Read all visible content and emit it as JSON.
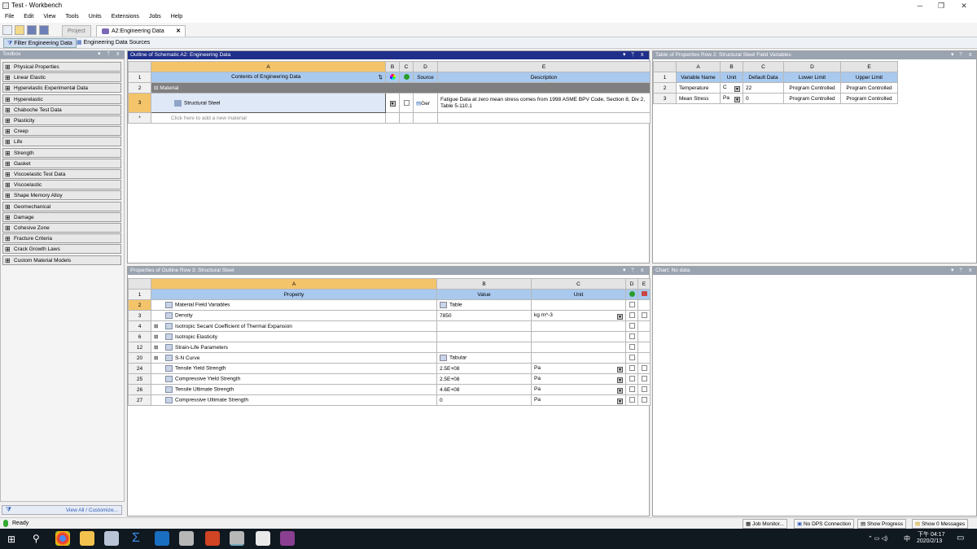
{
  "window": {
    "title": "Test - Workbench"
  },
  "menu": [
    "File",
    "Edit",
    "View",
    "Tools",
    "Units",
    "Extensions",
    "Jobs",
    "Help"
  ],
  "tabs": {
    "project": "Project",
    "engineering": "A2:Engineering Data"
  },
  "subbar": {
    "filter": "Filter Engineering Data",
    "sources": "Engineering Data Sources"
  },
  "toolbox": {
    "title": "Toolbox",
    "items": [
      "Physical Properties",
      "Linear Elastic",
      "Hyperelastic Experimental Data",
      "Hyperelastic",
      "Chaboche Test Data",
      "Plasticity",
      "Creep",
      "Life",
      "Strength",
      "Gasket",
      "Viscoelastic Test Data",
      "Viscoelastic",
      "Shape Memory Alloy",
      "Geomechanical",
      "Damage",
      "Cohesive Zone",
      "Fracture Criteria",
      "Crack Growth Laws",
      "Custom Material Models"
    ],
    "footer": "View All / Customize..."
  },
  "outline": {
    "title": "Outline of Schematic A2: Engineering Data",
    "cols": [
      "A",
      "B",
      "C",
      "D",
      "E"
    ],
    "header": {
      "contents": "Contents of Engineering Data",
      "source": "Source",
      "description": "Description"
    },
    "group": "Material",
    "material": {
      "name": "Structural Steel",
      "source": "Ger",
      "description": "Fatigue Data at zero mean stress comes from 1998 ASME BPV Code, Section 8, Div 2, Table 5-110.1"
    },
    "add_hint": "Click here to add a new material",
    "rows": [
      "1",
      "2",
      "3",
      "*"
    ]
  },
  "fieldvars": {
    "title": "Table of Properties Row 2: Structural Steel Field Variables",
    "cols": [
      "A",
      "B",
      "C",
      "D",
      "E"
    ],
    "header": [
      "Variable Name",
      "Unit",
      "Default Data",
      "Lower Limit",
      "Upper Limit"
    ],
    "rows": [
      {
        "n": "2",
        "name": "Temperature",
        "unit": "C",
        "def": "22",
        "lower": "Program Controlled",
        "upper": "Program Controlled"
      },
      {
        "n": "3",
        "name": "Mean Stress",
        "unit": "Pa",
        "def": "0",
        "lower": "Program Controlled",
        "upper": "Program Controlled"
      }
    ]
  },
  "properties": {
    "title": "Properties of Outline Row 3: Structural Steel",
    "cols": [
      "A",
      "B",
      "C",
      "D",
      "E"
    ],
    "header": {
      "property": "Property",
      "value": "Value",
      "unit": "Unit"
    },
    "rows": [
      {
        "n": "2",
        "exp": false,
        "name": "Material Field Variables",
        "value": "Table",
        "unit": "",
        "valIcon": true,
        "sel": true
      },
      {
        "n": "3",
        "exp": false,
        "name": "Density",
        "value": "7850",
        "unit": "kg m^-3"
      },
      {
        "n": "4",
        "exp": true,
        "name": "Isotropic Secant Coefficient of Thermal Expansion",
        "value": "",
        "unit": ""
      },
      {
        "n": "6",
        "exp": true,
        "name": "Isotropic Elasticity",
        "value": "",
        "unit": ""
      },
      {
        "n": "12",
        "exp": true,
        "name": "Strain-Life Parameters",
        "value": "",
        "unit": ""
      },
      {
        "n": "20",
        "exp": true,
        "name": "S-N Curve",
        "value": "Tabular",
        "unit": "",
        "valIcon": true
      },
      {
        "n": "24",
        "exp": false,
        "name": "Tensile Yield Strength",
        "value": "2.5E+08",
        "unit": "Pa"
      },
      {
        "n": "25",
        "exp": false,
        "name": "Compressive Yield Strength",
        "value": "2.5E+08",
        "unit": "Pa"
      },
      {
        "n": "26",
        "exp": false,
        "name": "Tensile Ultimate Strength",
        "value": "4.6E+08",
        "unit": "Pa"
      },
      {
        "n": "27",
        "exp": false,
        "name": "Compressive Ultimate Strength",
        "value": "0",
        "unit": "Pa"
      }
    ]
  },
  "chart": {
    "title": "Chart: No data"
  },
  "status": {
    "ready": "Ready",
    "job": "Job Monitor...",
    "dps": "No DPS Connection",
    "progress": "Show Progress",
    "messages": "Show 0 Messages"
  },
  "taskbar": {
    "time": "下午 04:17",
    "date": "2020/2/13",
    "ime": "中"
  },
  "colors": {
    "accent_blue": "#1f2f8a",
    "selected_orange": "#f4c46a",
    "header_blue": "#a9c9ee"
  }
}
